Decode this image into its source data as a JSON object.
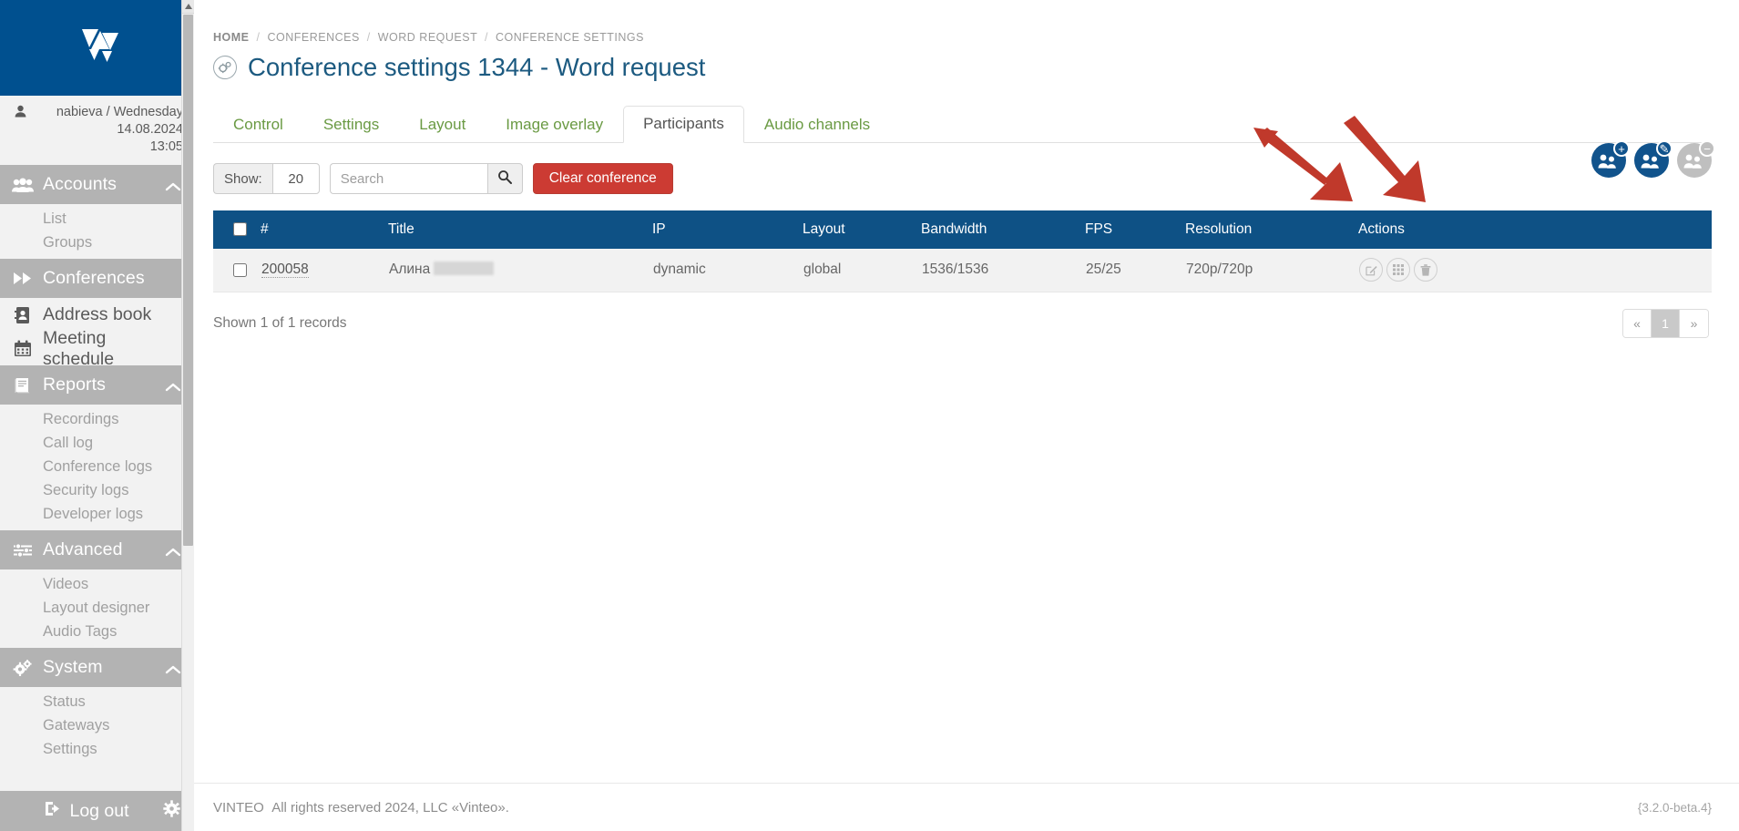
{
  "sidebar": {
    "logo_icon": "vinteo-w-logo",
    "user": {
      "icon": "user-icon",
      "line1": "nabieva / Wednesday 14.08.2024",
      "line2": "13:05"
    },
    "groups": [
      {
        "label": "Accounts",
        "icon": "users-group-icon",
        "expanded": true,
        "children": [
          "List",
          "Groups"
        ]
      },
      {
        "label": "Conferences",
        "icon": "fast-forward-icon",
        "expanded": false,
        "children": []
      },
      {
        "label": "Address book",
        "icon": "address-book-icon",
        "expanded": null,
        "children": []
      },
      {
        "label": "Meeting schedule",
        "icon": "calendar-icon",
        "expanded": null,
        "children": []
      },
      {
        "label": "Reports",
        "icon": "book-icon",
        "expanded": true,
        "children": [
          "Recordings",
          "Call log",
          "Conference logs",
          "Security logs",
          "Developer logs"
        ]
      },
      {
        "label": "Advanced",
        "icon": "sliders-icon",
        "expanded": true,
        "children": [
          "Videos",
          "Layout designer",
          "Audio Tags"
        ]
      },
      {
        "label": "System",
        "icon": "cogs-icon",
        "expanded": true,
        "children": [
          "Status",
          "Gateways",
          "Settings"
        ]
      }
    ],
    "logout": {
      "label": "Log out",
      "icon": "logout-icon",
      "settings_icon": "gear-icon"
    }
  },
  "breadcrumb": {
    "items": [
      "HOME",
      "CONFERENCES",
      "WORD REQUEST",
      "CONFERENCE SETTINGS"
    ],
    "separator": "/"
  },
  "page": {
    "title": "Conference settings 1344 - Word request",
    "title_icon": "cogs-circle-icon",
    "title_color": "#1c5a80"
  },
  "tabs": {
    "items": [
      {
        "label": "Control",
        "active": false
      },
      {
        "label": "Settings",
        "active": false
      },
      {
        "label": "Layout",
        "active": false
      },
      {
        "label": "Image overlay",
        "active": false
      },
      {
        "label": "Participants",
        "active": true
      },
      {
        "label": "Audio channels",
        "active": false
      }
    ],
    "inactive_color": "#6a9a43",
    "active_color": "#555555"
  },
  "toolbar": {
    "show_label": "Show:",
    "show_value": "20",
    "search_placeholder": "Search",
    "search_value": "",
    "search_icon": "search-icon",
    "clear_conference_label": "Clear conference",
    "clear_conference_color": "#cc3b33",
    "right_actions": [
      {
        "name": "add-participants-button",
        "icon": "users-plus-icon",
        "badge": "+",
        "color": "#11538c",
        "enabled": true
      },
      {
        "name": "edit-participants-button",
        "icon": "users-edit-icon",
        "badge": "✎",
        "color": "#11538c",
        "enabled": true
      },
      {
        "name": "remove-participants-button",
        "icon": "users-minus-icon",
        "badge": "−",
        "color": "#bfbfbf",
        "enabled": false
      }
    ],
    "annotation_arrows": 2,
    "annotation_color": "#c0392b"
  },
  "table": {
    "select_all_checked": false,
    "columns": [
      "#",
      "Title",
      "IP",
      "Layout",
      "Bandwidth",
      "FPS",
      "Resolution",
      "Actions"
    ],
    "header_bg": "#0e5185",
    "rows": [
      {
        "checked": false,
        "id": "200058",
        "title": "Алина",
        "title_redacted": true,
        "ip": "dynamic",
        "layout": "global",
        "bandwidth": "1536/1536",
        "fps": "25/25",
        "resolution": "720p/720p",
        "actions": [
          {
            "name": "edit-participant-icon",
            "glyph": "edit-square-icon"
          },
          {
            "name": "layout-participant-icon",
            "glyph": "grid-icon"
          },
          {
            "name": "delete-participant-icon",
            "glyph": "trash-icon"
          }
        ]
      }
    ]
  },
  "footer_table": {
    "records_text": "Shown 1 of 1 records",
    "pager": {
      "prev": "«",
      "pages": [
        "1"
      ],
      "next": "»",
      "current": "1"
    }
  },
  "page_footer": {
    "brand": "VINTEO",
    "copyright": "All rights reserved 2024, LLC «Vinteo».",
    "version": "{3.2.0-beta.4}"
  }
}
